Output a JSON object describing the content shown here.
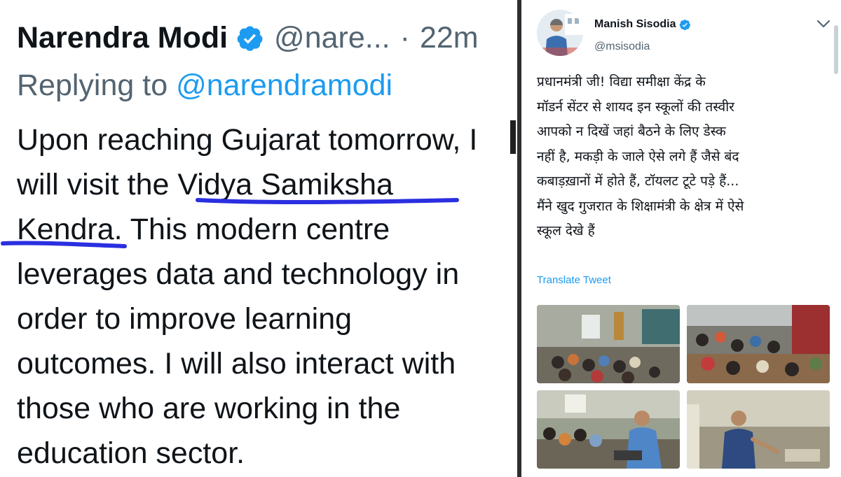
{
  "left_tweet": {
    "author_name": "Narendra Modi",
    "handle": "@nare...",
    "separator": "·",
    "time": "22m",
    "replying_prefix": "Replying to",
    "replying_to": "@narendramodi",
    "lines": [
      "Upon reaching Gujarat tomorrow, I",
      "will visit the Vidya Samiksha",
      "Kendra. This modern centre",
      "leverages data and technology in",
      "order to improve learning",
      "outcomes. I will also interact with",
      "those who are working in the",
      "education sector."
    ]
  },
  "right_tweet": {
    "author_name": "Manish Sisodia",
    "handle": "@msisodia",
    "lines": [
      "प्रधानमंत्री जी! विद्या समीक्षा केंद्र के",
      "मॉडर्न सेंटर से शायद इन स्कूलों की तस्वीर",
      "आपको न दिखें जहां बैठने के लिए डेस्क",
      "नहीं है, मकड़ी के जाले ऐसे लगे हैं जैसे बंद",
      "कबाड़ख़ानों में होते हैं, टॉयलट टूटे पड़े हैं...",
      "मैंने खुद गुजरात के शिक्षामंत्री के क्षेत्र में ऐसे",
      "स्कूल देखे हैं"
    ],
    "translate_label": "Translate Tweet",
    "photo_count": 4
  },
  "colors": {
    "verified": "#1d9bf0",
    "link": "#1d9bf0",
    "ink_underline": "#2b2fe0",
    "text_primary": "#0f1419",
    "text_secondary": "#536471"
  },
  "icons": [
    "verified-badge-icon",
    "more-chevron-icon"
  ]
}
